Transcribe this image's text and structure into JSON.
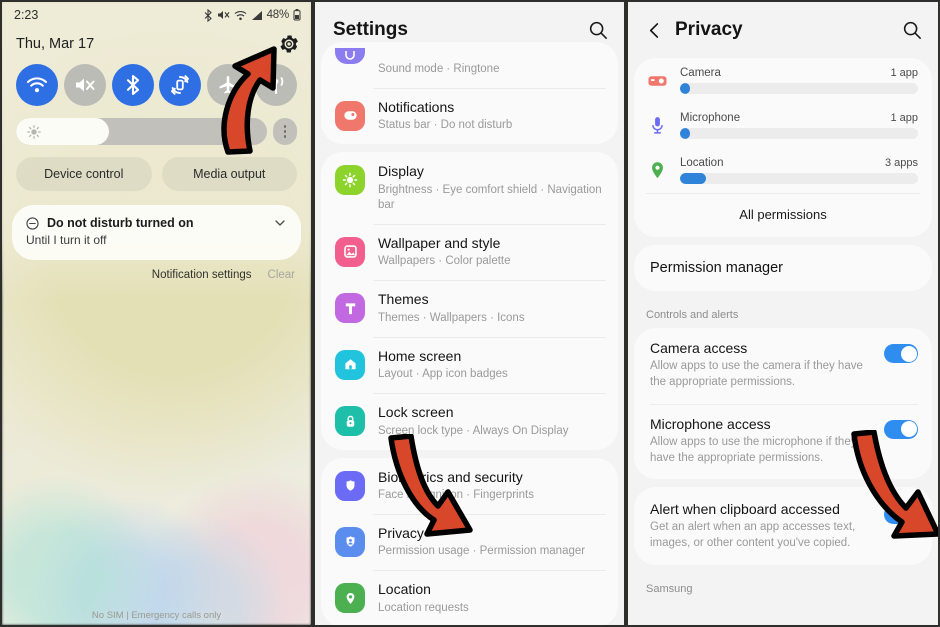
{
  "panel1": {
    "status_bar": {
      "time": "2:23",
      "battery_pct": "48%",
      "icons": [
        "bluetooth-icon",
        "mute-icon",
        "wifi-icon",
        "signal-icon",
        "battery-icon"
      ]
    },
    "date": "Thu, Mar 17",
    "gear_icon": "gear-icon",
    "quick_toggles": [
      {
        "name": "wifi",
        "icon": "wifi-icon",
        "state": "on"
      },
      {
        "name": "sound",
        "icon": "mute-icon",
        "state": "off"
      },
      {
        "name": "bluetooth",
        "icon": "bluetooth-icon",
        "state": "on"
      },
      {
        "name": "auto-rotate",
        "icon": "rotate-icon",
        "state": "on"
      },
      {
        "name": "airplane-mode",
        "icon": "airplane-icon",
        "state": "off"
      },
      {
        "name": "mobile-hotspot",
        "icon": "hotspot-icon",
        "state": "off"
      }
    ],
    "brightness": {
      "icon": "brightness-icon",
      "value_pct": 37,
      "more_icon": "kebab-icon"
    },
    "buttons": {
      "device_control": "Device control",
      "media_output": "Media output"
    },
    "notification": {
      "icon": "do-not-disturb-icon",
      "title": "Do not disturb turned on",
      "subtitle": "Until I turn it off",
      "expand_icon": "chevron-down-icon"
    },
    "notif_actions": {
      "settings": "Notification settings",
      "clear": "Clear"
    },
    "footer": "No SIM | Emergency calls only"
  },
  "panel2": {
    "title": "Settings",
    "search_icon": "search-icon",
    "groups": [
      {
        "items": [
          {
            "title": "",
            "subtitle": "Sound mode  ·  Ringtone",
            "icon": "sound-icon",
            "color": "#8B7CF0",
            "partial": true
          },
          {
            "title": "Notifications",
            "subtitle": "Status bar  ·  Do not disturb",
            "icon": "notifications-icon",
            "color": "#F0776B"
          }
        ]
      },
      {
        "items": [
          {
            "title": "Display",
            "subtitle": "Brightness  ·  Eye comfort shield  ·  Navigation bar",
            "icon": "display-icon",
            "color": "#8CD42B"
          },
          {
            "title": "Wallpaper and style",
            "subtitle": "Wallpapers  ·  Color palette",
            "icon": "wallpaper-icon",
            "color": "#F25E8E"
          },
          {
            "title": "Themes",
            "subtitle": "Themes  ·  Wallpapers  ·  Icons",
            "icon": "themes-icon",
            "color": "#C268E0"
          },
          {
            "title": "Home screen",
            "subtitle": "Layout  ·  App icon badges",
            "icon": "home-icon",
            "color": "#22C3DD"
          },
          {
            "title": "Lock screen",
            "subtitle": "Screen lock type  ·  Always On Display",
            "icon": "lock-icon",
            "color": "#1EBFA8"
          }
        ]
      },
      {
        "items": [
          {
            "title": "Biometrics and security",
            "subtitle": "Face recognition  ·  Fingerprints",
            "icon": "security-icon",
            "color": "#6B6BF5"
          },
          {
            "title": "Privacy",
            "subtitle": "Permission usage  ·  Permission manager",
            "icon": "privacy-icon",
            "color": "#5B8DEF"
          },
          {
            "title": "Location",
            "subtitle": "Location requests",
            "icon": "location-icon",
            "color": "#4CAF50"
          }
        ]
      }
    ]
  },
  "panel3": {
    "title": "Privacy",
    "back_icon": "back-arrow-icon",
    "search_icon": "search-icon",
    "permissions": [
      {
        "name": "Camera",
        "count": "1 app",
        "icon": "camera-icon",
        "color": "#F0776B",
        "bar_pct": 4
      },
      {
        "name": "Microphone",
        "count": "1 app",
        "icon": "microphone-icon",
        "color": "#6B6BF5",
        "bar_pct": 4
      },
      {
        "name": "Location",
        "count": "3 apps",
        "icon": "location-icon",
        "color": "#4CAF50",
        "bar_pct": 11
      }
    ],
    "all_permissions": "All permissions",
    "permission_manager": "Permission manager",
    "section_header": "Controls and alerts",
    "toggles": [
      {
        "title": "Camera access",
        "subtitle": "Allow apps to use the camera if they have the appropriate permissions.",
        "state": "on"
      },
      {
        "title": "Microphone access",
        "subtitle": "Allow apps to use the microphone if they have the appropriate permissions.",
        "state": "on"
      },
      {
        "title": "Alert when clipboard accessed",
        "subtitle": "Get an alert when an app accesses text, images, or other content you've copied.",
        "state": "on"
      }
    ],
    "brand_footer": "Samsung"
  },
  "annotations": {
    "arrow_color": "#D9472B",
    "arrow_outline": "#000000"
  }
}
